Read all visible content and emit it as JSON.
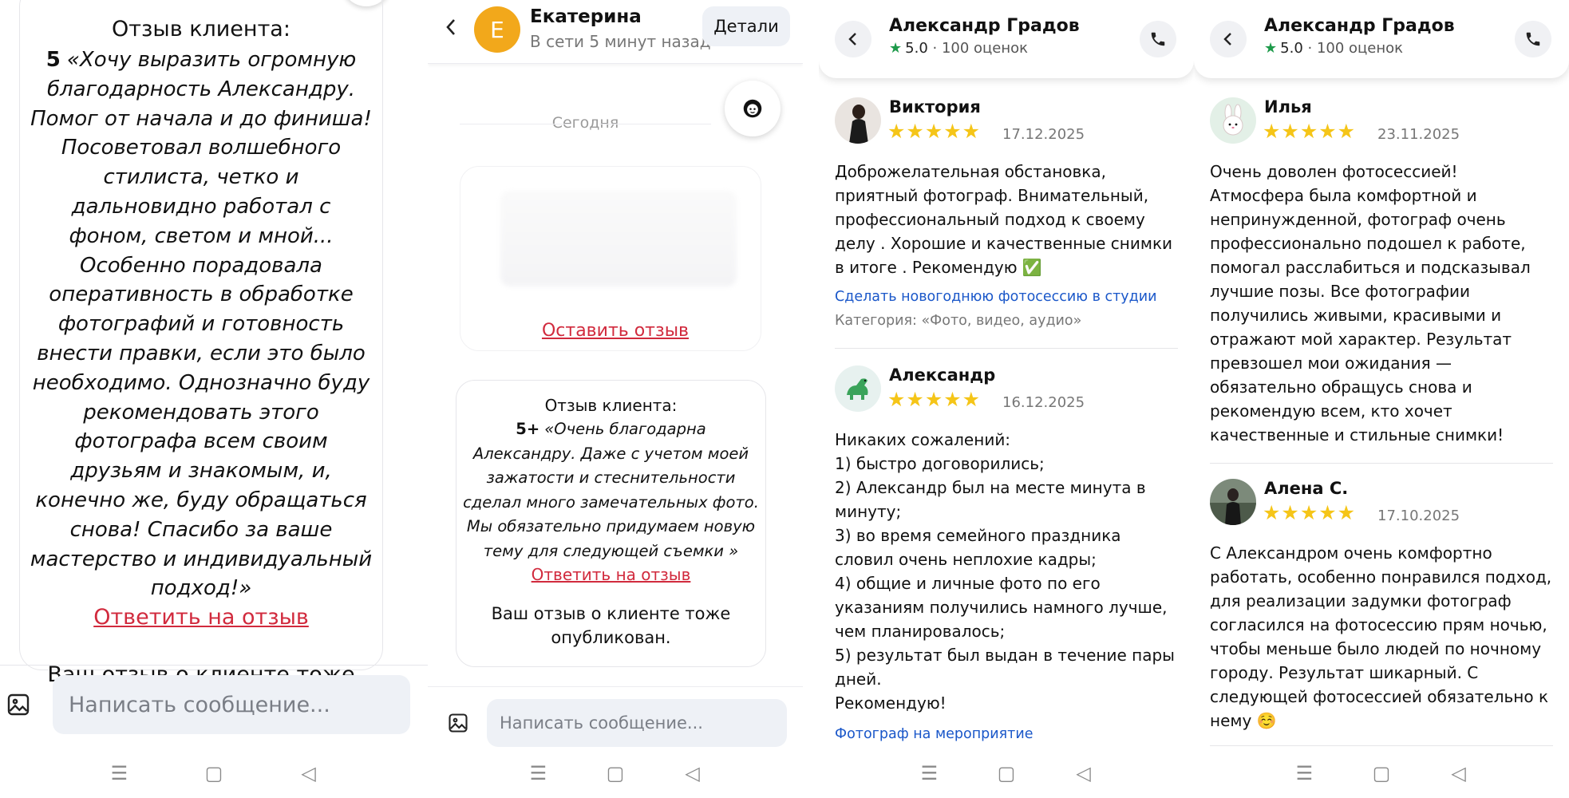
{
  "screen1": {
    "title": "Отзыв клиента:",
    "score": "5",
    "text": "«Хочу выразить огромную благодарность Александру. Помог от начала и до финиша! Посоветовал волшебного стилиста, четко и дальновидно работал с фоном, светом и мной... Особенно порадовала оперативность в обработке фотографий и готовность внести правки, если это было необходимо. Однозначно буду рекомендовать этого фотографа всем своим друзьям и знакомым, и, конечно же, буду обращаться снова! Спасибо за ваше мастерство и индивидуальный подход!»",
    "reply": "Ответить на отзыв",
    "published": "Ваш отзыв о клиенте тоже опубликован.",
    "placeholder": "Написать сообщение..."
  },
  "screen2": {
    "avatar_letter": "Е",
    "name": "Екатерина",
    "status": "В сети 5 минут назад",
    "details": "Детали",
    "day": "Сегодня",
    "leave_review": "Оставить отзыв",
    "title": "Отзыв клиента:",
    "score": "5+",
    "text": "«Очень благодарна Александру. Даже с учетом моей зажатости и стеснительности сделал много замечательных фото. Мы обязательно придумаем новую тему для следующей съемки »",
    "reply": "Ответить на отзыв",
    "published": "Ваш отзыв о клиенте тоже опубликован.",
    "placeholder": "Написать сообщение..."
  },
  "screen3": {
    "name": "Александр Градов",
    "rating": "5.0",
    "count": "100 оценок",
    "reviews": [
      {
        "name": "Виктория",
        "stars": "★★★★★",
        "date": "17.12.2025",
        "text": "Доброжелательная обстановка, приятный фотограф. Внимательный, профессиональный подход к своему делу . Хорошие и качественные снимки в итоге . Рекомендую ✅",
        "link": "Сделать новогоднюю фотосессию в студии",
        "category": "Категория: «Фото, видео, аудио»"
      },
      {
        "name": "Александр",
        "stars": "★★★★★",
        "date": "16.12.2025",
        "text": "Никаких сожалений:\n1) быстро договорились;\n2) Александр был на месте минута в минуту;\n3) во время семейного праздника словил очень неплохие кадры;\n4) общие и личные фото по его указаниям получились намного лучше, чем планировалось;\n5) результат был выдан в течение пары дней.\nРекомендую!",
        "link": "Фотограф на мероприятие"
      }
    ]
  },
  "screen4": {
    "name": "Александр Градов",
    "rating": "5.0",
    "count": "100 оценок",
    "reviews": [
      {
        "name": "Илья",
        "stars": "★★★★★",
        "date": "23.11.2025",
        "text": "Очень доволен фотосессией! Атмосфера была комфортной и непринужденной, фотограф очень профессионально подошел к работе, помогал расслабиться и подсказывал лучшие позы. Все фотографии получились живыми, красивыми и отражают мой характер. Результат превзошел мои ожидания — обязательно обращусь снова и рекомендую всем, кто хочет качественные и стильные снимки!"
      },
      {
        "name": "Алена С.",
        "stars": "★★★★★",
        "date": "17.10.2025",
        "text": "С Александром очень комфортно работать, особенно понравился подход, для реализации задумки фотограф согласился на фотосессию прям ночью, чтобы меньше было людей по ночному городу. Результат шикарный. С следующей фотосессией обязательно к нему ☺️"
      }
    ]
  },
  "nav": {
    "menu": "☰",
    "home": "▢",
    "back": "◁"
  },
  "colors": {
    "accent_red": "#d12a3d",
    "link_blue": "#1a57c9",
    "star": "#f5c518",
    "avatar_orange": "#f2a81b"
  },
  "icons": [
    "image-icon",
    "back-chevron-icon",
    "phone-icon",
    "star-icon",
    "face-icon"
  ]
}
